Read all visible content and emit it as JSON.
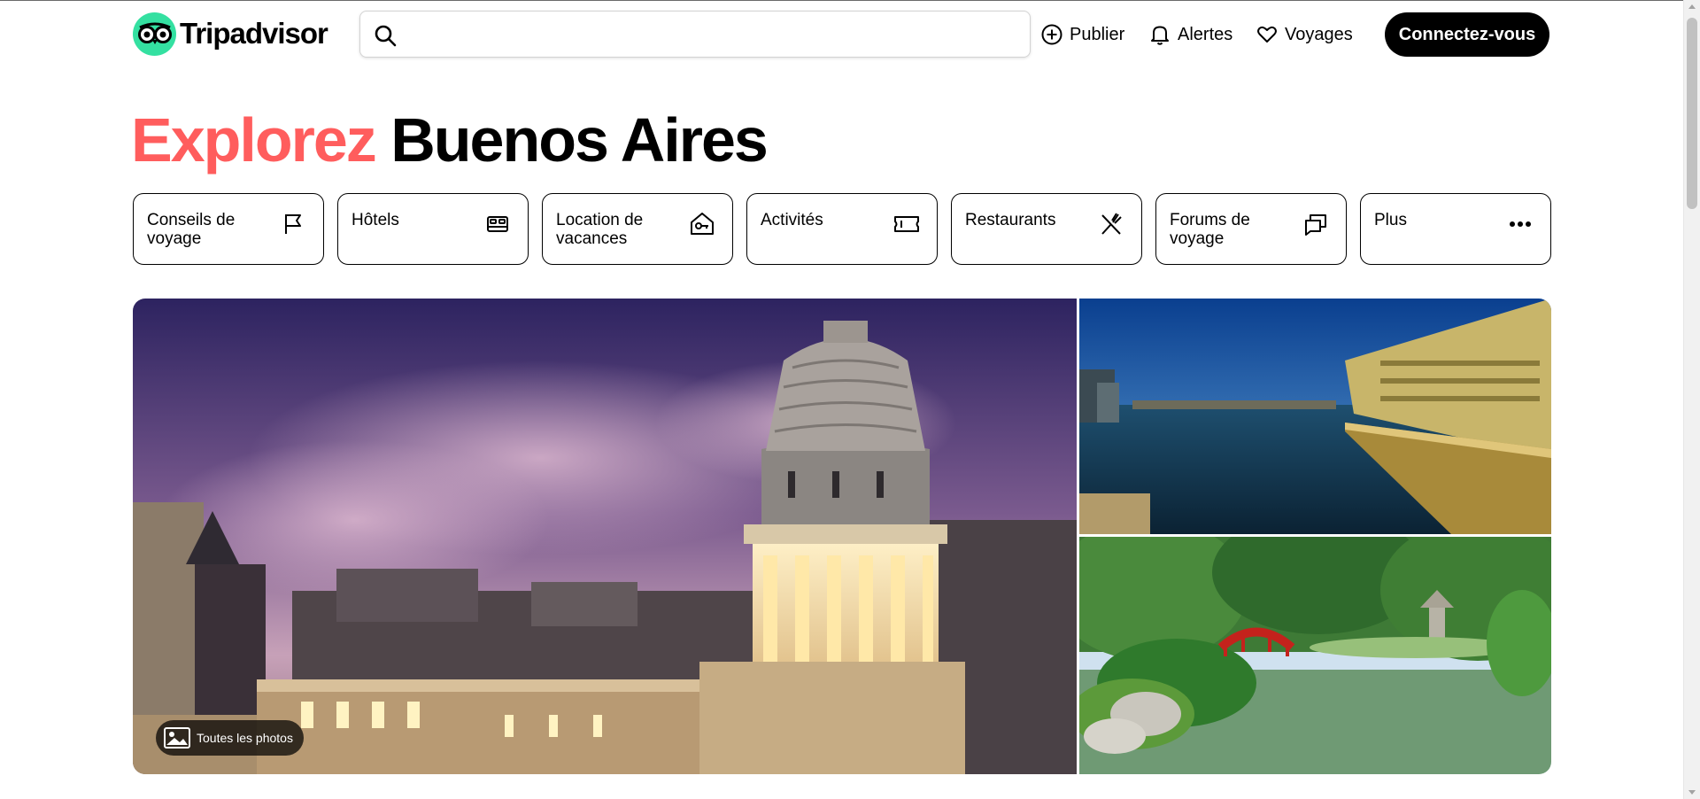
{
  "header": {
    "logo_text": "Tripadvisor",
    "search": {
      "value": "",
      "placeholder": ""
    },
    "nav": {
      "publier": "Publier",
      "alertes": "Alertes",
      "voyages": "Voyages"
    },
    "connect_label": "Connectez-vous"
  },
  "hero": {
    "title_accent": "Explorez",
    "title_place": "Buenos Aires"
  },
  "categories": [
    {
      "label": "Conseils de voyage",
      "icon": "flag-icon"
    },
    {
      "label": "Hôtels",
      "icon": "bed-icon"
    },
    {
      "label": "Location de vacances",
      "icon": "house-key-icon"
    },
    {
      "label": "Activités",
      "icon": "ticket-icon"
    },
    {
      "label": "Restaurants",
      "icon": "cutlery-icon"
    },
    {
      "label": "Forums de voyage",
      "icon": "chat-bubbles-icon"
    },
    {
      "label": "Plus",
      "icon": "more-dots-icon"
    }
  ],
  "gallery": {
    "all_photos_label": "Toutes les photos"
  },
  "colors": {
    "accent": "#ff5d5d",
    "brand_green": "#34e0a1",
    "button_black": "#000000"
  }
}
